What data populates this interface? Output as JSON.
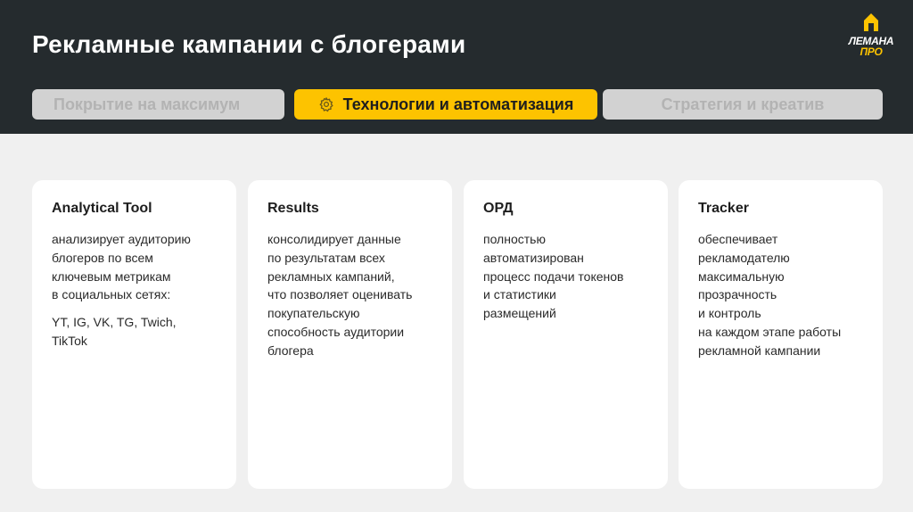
{
  "header": {
    "title": "Рекламные кампании с блогерами"
  },
  "logo": {
    "line1": "ЛЕМАНА",
    "line2": "ПРО",
    "icon": "house-logo-icon"
  },
  "tabs": [
    {
      "label": "Покрытие на максимум",
      "active": false
    },
    {
      "label": "Технологии и автоматизация",
      "active": true,
      "icon": "gear-icon"
    },
    {
      "label": "Стратегия и креатив",
      "active": false
    }
  ],
  "cards": [
    {
      "title": "Analytical Tool",
      "lines": [
        "анализирует аудиторию",
        "блогеров по всем",
        "ключевым метрикам",
        "в социальных сетях:"
      ],
      "extra": [
        "YT, IG, VK, TG, Twich,",
        "TikTok"
      ]
    },
    {
      "title": "Results",
      "lines": [
        "консолидирует данные",
        "по результатам всех",
        "рекламных кампаний,",
        "что позволяет оценивать",
        "покупательскую",
        "способность аудитории",
        "блогера"
      ]
    },
    {
      "title": "ОРД",
      "lines": [
        "полностью",
        "автоматизирован",
        "процесс подачи токенов",
        "и статистики",
        "размещений"
      ]
    },
    {
      "title": "Tracker",
      "lines": [
        "обеспечивает",
        "рекламодателю",
        "максимальную",
        "прозрачность",
        "и контроль",
        "на каждом этапе работы",
        "рекламной кампании"
      ]
    }
  ],
  "colors": {
    "header_bg": "#252b2e",
    "accent": "#fdc300",
    "tab_inactive_bg": "#d2d2d2",
    "tab_inactive_text": "#b3b3b3",
    "page_bg": "#f0f0f0",
    "card_bg": "#ffffff"
  }
}
